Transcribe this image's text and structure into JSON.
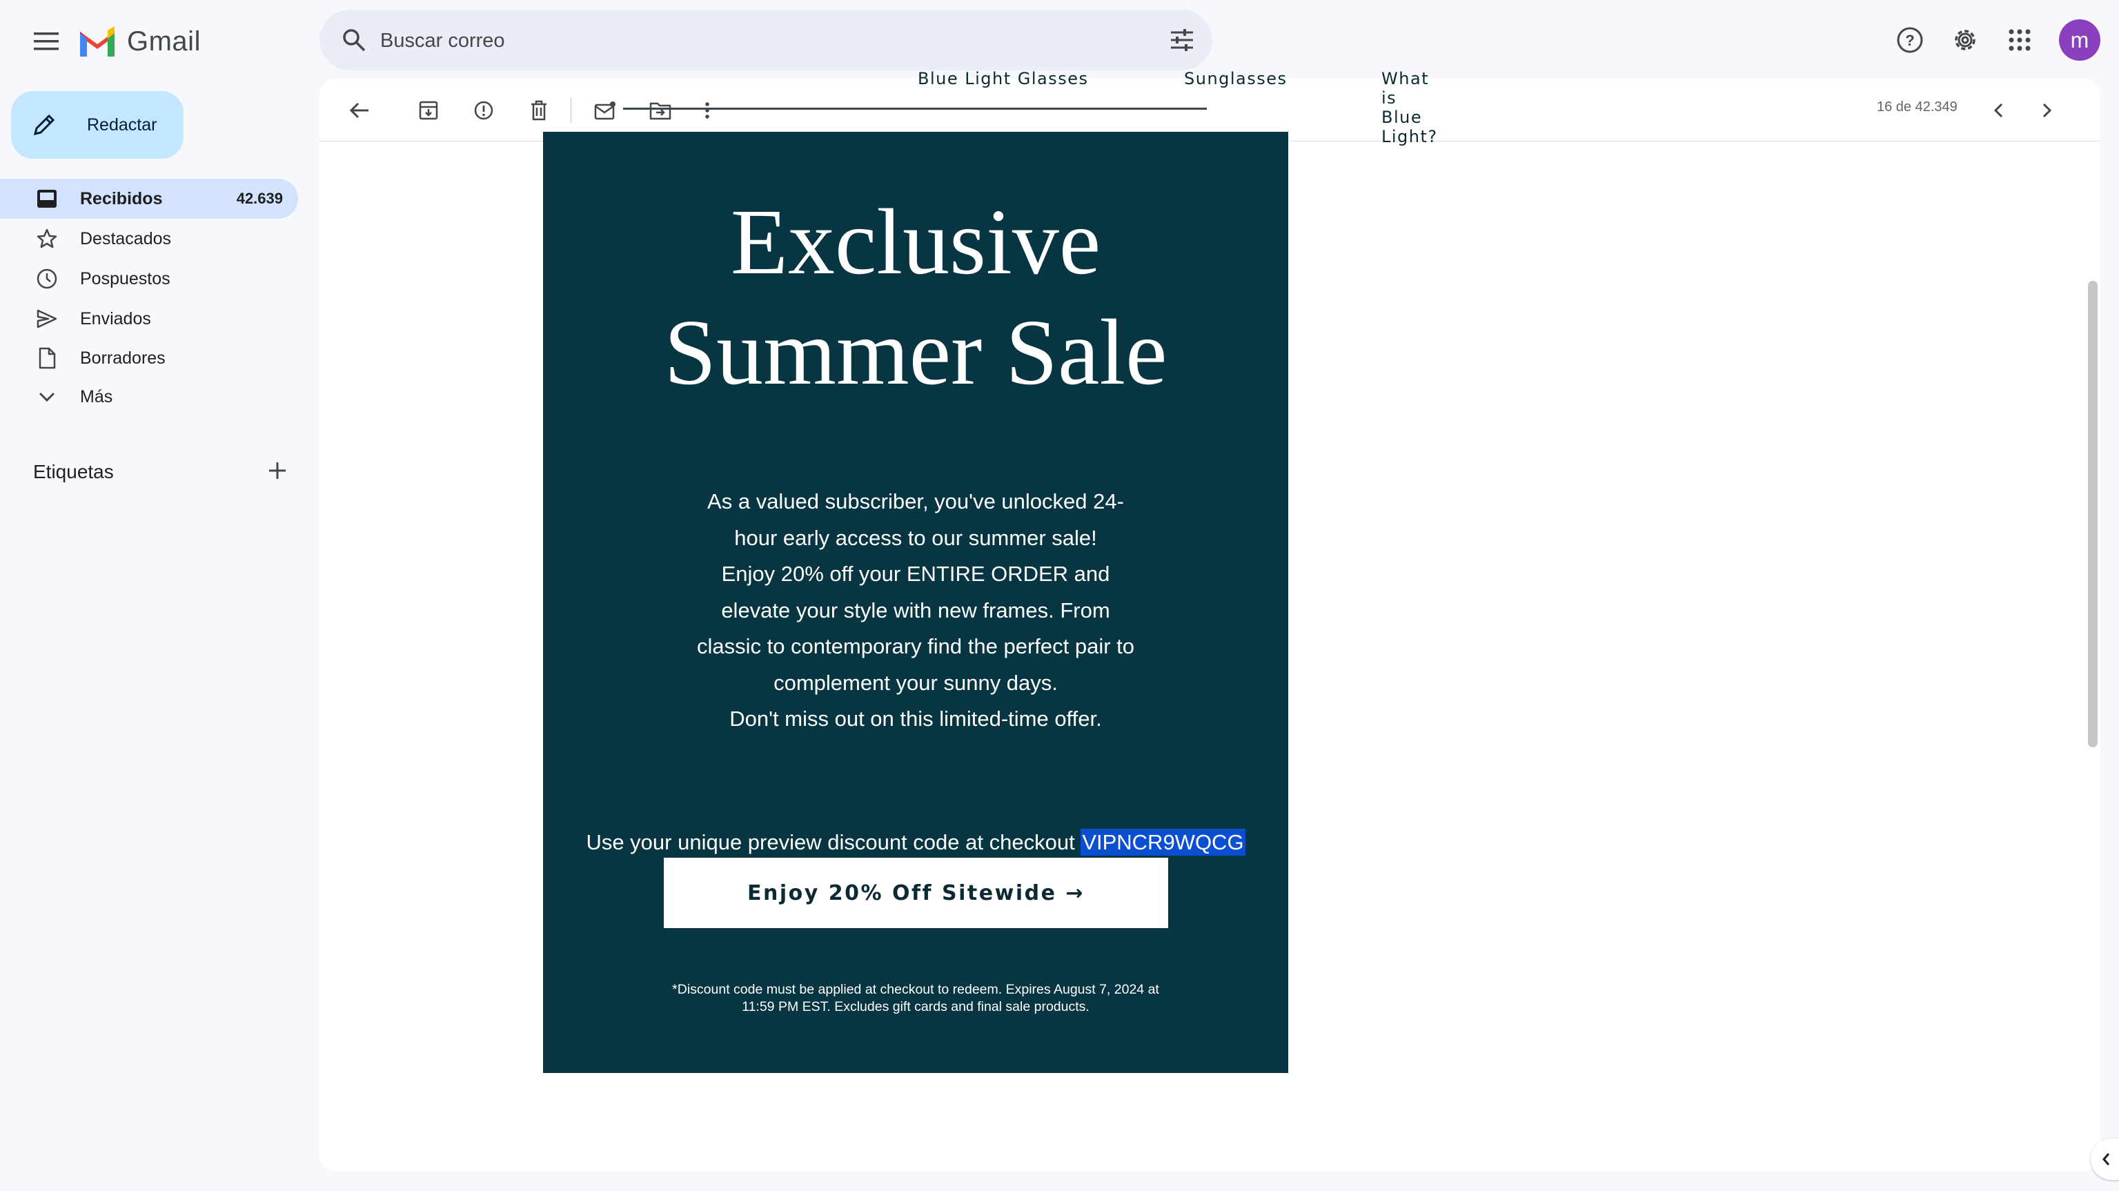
{
  "app": {
    "name": "Gmail"
  },
  "search": {
    "placeholder": "Buscar correo"
  },
  "header": {
    "avatar_initial": "m"
  },
  "compose": {
    "label": "Redactar"
  },
  "sidebar": {
    "items": [
      {
        "label": "Recibidos",
        "count": "42.639",
        "icon": "inbox-icon",
        "active": true
      },
      {
        "label": "Destacados",
        "count": "",
        "icon": "star-icon"
      },
      {
        "label": "Pospuestos",
        "count": "",
        "icon": "clock-icon"
      },
      {
        "label": "Enviados",
        "count": "",
        "icon": "send-icon"
      },
      {
        "label": "Borradores",
        "count": "",
        "icon": "draft-icon"
      },
      {
        "label": "Más",
        "count": "",
        "icon": "chevron-down-icon"
      }
    ],
    "labels_title": "Etiquetas"
  },
  "toolbar": {
    "pager": "16 de 42.349"
  },
  "email": {
    "nav": [
      "Blue Light Glasses",
      "Sunglasses",
      "What is Blue Light?"
    ],
    "headline": [
      "Exclusive",
      "Summer Sale"
    ],
    "body_lines": [
      "As a valued subscriber, you've unlocked 24-",
      "hour early access to our summer sale!",
      "Enjoy 20% off your ENTIRE ORDER and",
      "elevate your style with new frames. From",
      "classic to contemporary find the perfect pair to",
      "complement your sunny days.",
      "Don't miss out on this limited-time offer."
    ],
    "code_prefix": "Use your unique preview discount code at checkout ",
    "code": "VIPNCR9WQCG",
    "cta": "Enjoy 20% Off Sitewide →",
    "disclaimer_lines": [
      "*Discount code must be applied at checkout to redeem. Expires August 7, 2024 at",
      "11:59 PM EST. Excludes gift cards and final sale products."
    ]
  },
  "colors": {
    "banner_bg": "#073642",
    "code_highlight": "#0b4fd1",
    "compose_bg": "#c2e7ff",
    "active_nav_bg": "#d3e3fd",
    "avatar_bg": "#8a3fbf"
  }
}
